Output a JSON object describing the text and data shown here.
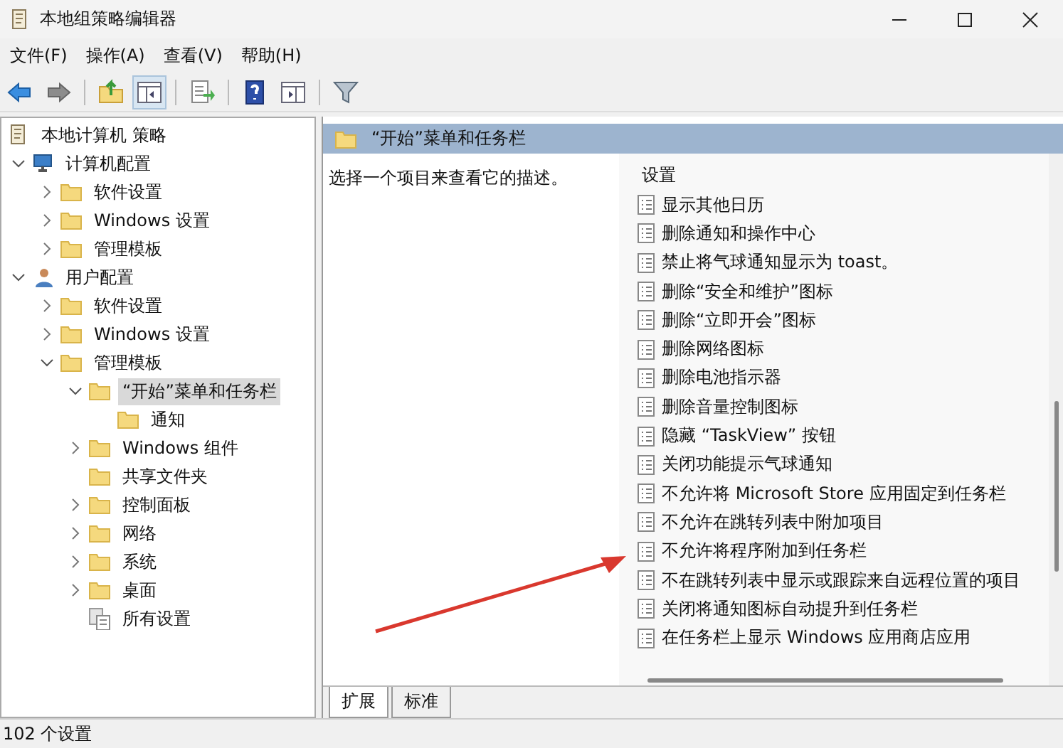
{
  "window": {
    "title": "本地组策略编辑器"
  },
  "menu": [
    "文件(F)",
    "操作(A)",
    "查看(V)",
    "帮助(H)"
  ],
  "toolbar": [
    [
      {
        "kind": "back",
        "pressed": false
      },
      {
        "kind": "forward",
        "pressed": false
      }
    ],
    [
      {
        "kind": "up",
        "pressed": false
      },
      {
        "kind": "tree",
        "pressed": true
      }
    ],
    [
      {
        "kind": "export",
        "pressed": false
      }
    ],
    [
      {
        "kind": "help",
        "pressed": false
      },
      {
        "kind": "pane",
        "pressed": false
      }
    ],
    [
      {
        "kind": "filter",
        "pressed": false
      }
    ]
  ],
  "tree": [
    {
      "label": "本地计算机 策略",
      "kind": "policy",
      "selected": false,
      "children": [
        {
          "label": "计算机配置",
          "kind": "computer",
          "expanded": true,
          "selected": false,
          "children": [
            {
              "label": "软件设置",
              "kind": "folder",
              "expanded": false,
              "selected": false
            },
            {
              "label": "Windows 设置",
              "kind": "folder",
              "expanded": false,
              "selected": false
            },
            {
              "label": "管理模板",
              "kind": "folder",
              "expanded": false,
              "selected": false
            }
          ]
        },
        {
          "label": "用户配置",
          "kind": "user",
          "expanded": true,
          "selected": false,
          "children": [
            {
              "label": "软件设置",
              "kind": "folder",
              "expanded": false,
              "selected": false
            },
            {
              "label": "Windows 设置",
              "kind": "folder",
              "expanded": false,
              "selected": false
            },
            {
              "label": "管理模板",
              "kind": "folder",
              "expanded": true,
              "selected": false,
              "children": [
                {
                  "label": "“开始”菜单和任务栏",
                  "kind": "folder",
                  "expanded": true,
                  "selected": true,
                  "children": [
                    {
                      "label": "通知",
                      "kind": "folder",
                      "selected": false
                    }
                  ]
                },
                {
                  "label": "Windows 组件",
                  "kind": "folder",
                  "expanded": false,
                  "selected": false
                },
                {
                  "label": "共享文件夹",
                  "kind": "folder",
                  "selected": false
                },
                {
                  "label": "控制面板",
                  "kind": "folder",
                  "expanded": false,
                  "selected": false
                },
                {
                  "label": "网络",
                  "kind": "folder",
                  "expanded": false,
                  "selected": false
                },
                {
                  "label": "系统",
                  "kind": "folder",
                  "expanded": false,
                  "selected": false
                },
                {
                  "label": "桌面",
                  "kind": "folder",
                  "expanded": false,
                  "selected": false
                },
                {
                  "label": "所有设置",
                  "kind": "settings",
                  "selected": false
                }
              ]
            }
          ]
        }
      ]
    }
  ],
  "details": {
    "header": "“开始”菜单和任务栏",
    "description": "选择一个项目来查看它的描述。",
    "column": "设置",
    "settings": [
      "显示其他日历",
      "删除通知和操作中心",
      "禁止将气球通知显示为 toast。",
      "删除“安全和维护”图标",
      "删除“立即开会”图标",
      "删除网络图标",
      "删除电池指示器",
      "删除音量控制图标",
      "隐藏 “TaskView” 按钮",
      "关闭功能提示气球通知",
      "不允许将 Microsoft Store 应用固定到任务栏",
      "不允许在跳转列表中附加项目",
      "不允许将程序附加到任务栏",
      "不在跳转列表中显示或跟踪来自远程位置的项目",
      "关闭将通知图标自动提升到任务栏",
      "在任务栏上显示 Windows 应用商店应用"
    ],
    "tabs": [
      {
        "label": "扩展",
        "selected": true
      },
      {
        "label": "标准",
        "selected": false
      }
    ]
  },
  "status_bar": "102 个设置"
}
